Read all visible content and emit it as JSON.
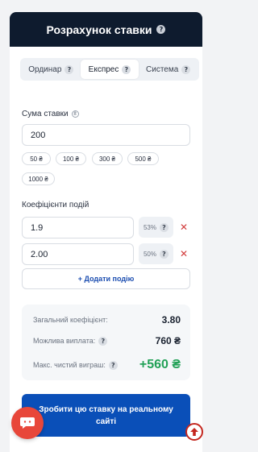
{
  "header": {
    "title": "Розрахунок ставки"
  },
  "tabs": [
    {
      "label": "Ординар"
    },
    {
      "label": "Експрес"
    },
    {
      "label": "Система"
    }
  ],
  "stake": {
    "label": "Сума ставки",
    "value": "200",
    "quick": [
      "50 ₴",
      "100 ₴",
      "300 ₴",
      "500 ₴",
      "1000 ₴"
    ]
  },
  "events": {
    "label": "Коефіцієнти подій",
    "items": [
      {
        "odds": "1.9",
        "prob": "53%"
      },
      {
        "odds": "2.00",
        "prob": "50%"
      }
    ],
    "add_label": "+ Додати подію"
  },
  "summary": {
    "total_coef_label": "Загальний коефіцієнт:",
    "total_coef": "3.80",
    "payout_label": "Можлива виплата:",
    "payout": "760 ₴",
    "net_label": "Макс. чистий виграш:",
    "net": "+560 ₴"
  },
  "cta": {
    "label": "Зробити цю ставку на реальному сайті"
  },
  "colors": {
    "header": "#0e1b2e",
    "accent": "#0a4fb8",
    "positive": "#22a157",
    "danger": "#d23b3b",
    "chat": "#e8473a"
  }
}
